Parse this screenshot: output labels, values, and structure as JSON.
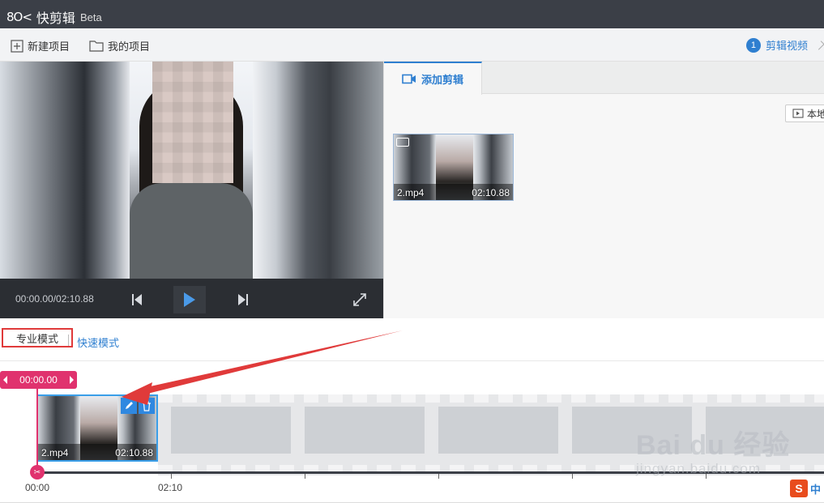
{
  "app": {
    "logo_mark": "8O<",
    "name": "快剪辑",
    "badge": "Beta"
  },
  "toolbar": {
    "new_project": "新建项目",
    "my_projects": "我的项目",
    "step_number": "1",
    "step_label": "剪辑视频"
  },
  "player": {
    "time": "00:00.00/02:10.88"
  },
  "panel": {
    "tab_add_clip": "添加剪辑",
    "local_button": "本地"
  },
  "library_clip": {
    "name": "2.mp4",
    "duration": "02:10.88"
  },
  "modes": {
    "pro": "专业模式",
    "fast": "快速模式"
  },
  "timeline": {
    "playhead_time": "00:00.00",
    "clip": {
      "name": "2.mp4",
      "duration": "02:10.88"
    },
    "ticks": [
      "00:00",
      "02:10"
    ]
  },
  "ime": {
    "logo": "S",
    "lang": "中"
  },
  "watermark": {
    "brand": "Bai du 经验",
    "url": "jingyan.baidu.com"
  },
  "colors": {
    "accent": "#2f7fd0",
    "playhead": "#e0326e",
    "highlight_box": "#e03a3a",
    "titlebar": "#3b3f47"
  }
}
